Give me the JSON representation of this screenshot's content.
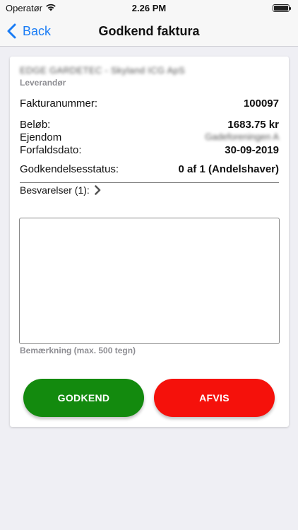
{
  "status_bar": {
    "carrier": "Operatør",
    "time": "2.26 PM"
  },
  "nav": {
    "back_label": "Back",
    "title": "Godkend faktura"
  },
  "invoice": {
    "supplier_name": "EDGE GARDETEC - Skyland ICG ApS",
    "supplier_label": "Leverandør",
    "invoice_number_label": "Fakturanummer:",
    "invoice_number": "100097",
    "amount_label": "Beløb:",
    "amount": "1683.75 kr",
    "property_label": "Ejendom",
    "property_value": "Gadeforeningen A",
    "due_date_label": "Forfaldsdato:",
    "due_date": "30-09-2019",
    "approval_status_label": "Godkendelsesstatus:",
    "approval_status": "0 af 1 (Andelshaver)",
    "answers_label": "Besvarelser (1):",
    "comment_value": "",
    "comment_hint": "Bemærkning (max. 500 tegn)"
  },
  "actions": {
    "approve_label": "GODKEND",
    "reject_label": "AFVIS"
  },
  "colors": {
    "accent": "#1a7cf5",
    "approve": "#138a0e",
    "reject": "#f5110b"
  }
}
